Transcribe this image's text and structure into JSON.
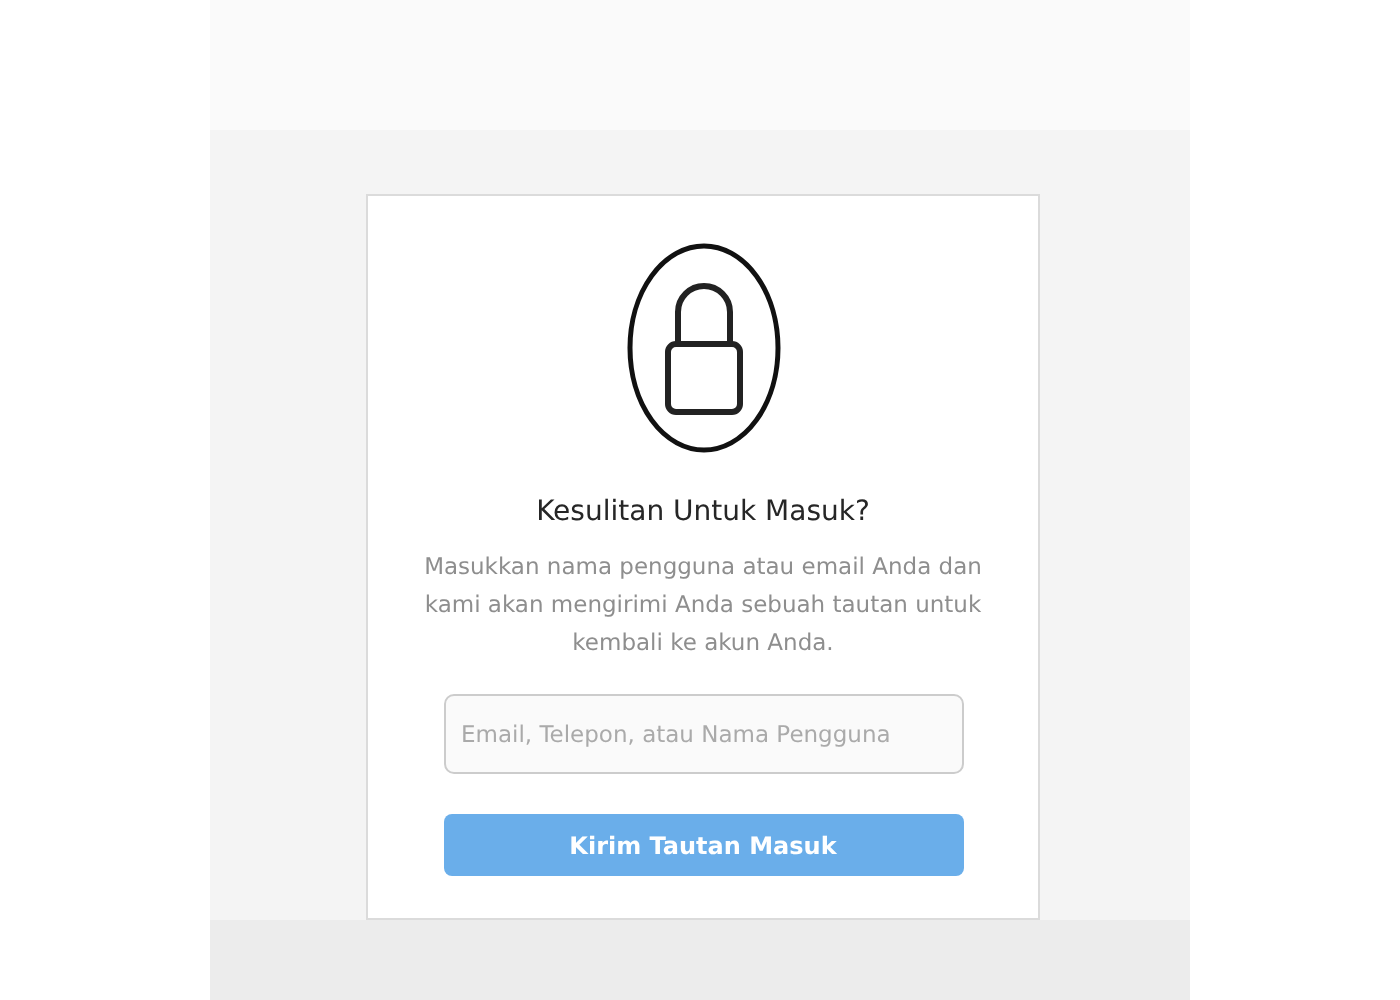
{
  "card": {
    "title": "Kesulitan Untuk Masuk?",
    "description": "Masukkan nama pengguna atau email Anda dan kami akan mengirimi Anda sebuah tautan untuk kembali ke akun Anda.",
    "field": {
      "placeholder": "Email, Telepon, atau Nama Pengguna"
    },
    "button": {
      "label": "Kirim Tautan Masuk",
      "disabled": true
    }
  }
}
